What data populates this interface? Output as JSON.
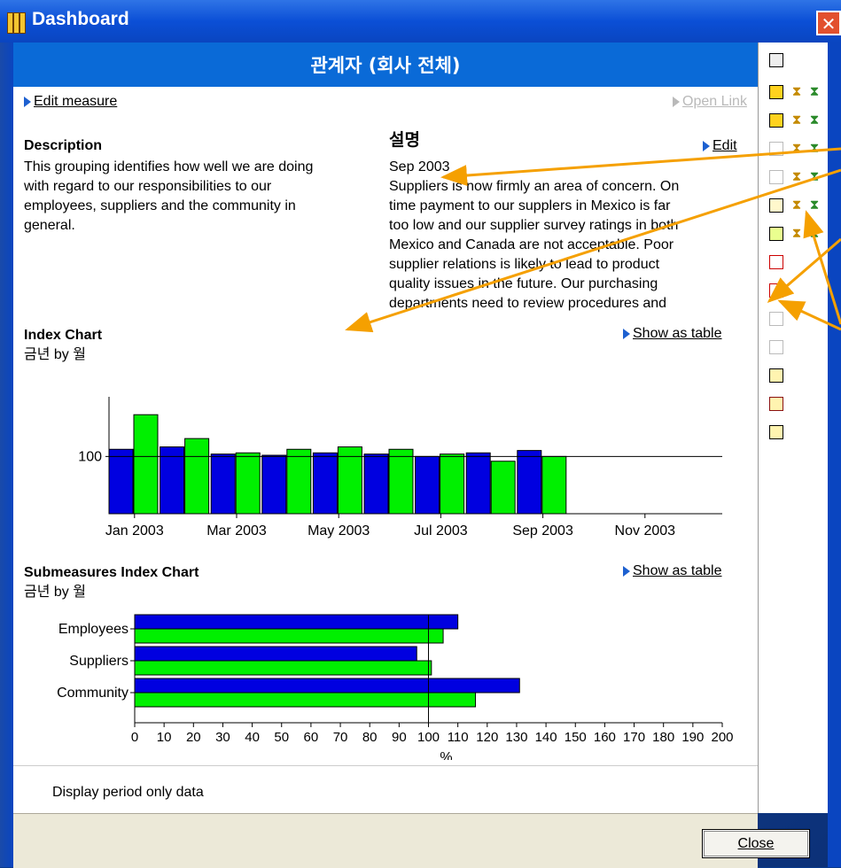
{
  "window": {
    "title": "Dashboard"
  },
  "header": {
    "title": "관계자 (회사 전체)"
  },
  "links": {
    "edit_measure": "Edit measure",
    "open_link": "Open Link",
    "edit": "Edit",
    "show_as_table_1": "Show as table",
    "show_as_table_2": "Show as table"
  },
  "description": {
    "heading": "Description",
    "lines": [
      "This grouping identifies how well we are doing",
      "with regard to our responsibilities to our",
      "employees, suppliers and the community in",
      "general."
    ]
  },
  "commentary": {
    "heading": "설명",
    "date": "Sep 2003",
    "lines": [
      "Suppliers is now firmly an area of concern.  On",
      "time payment to our supplers in Mexico is far",
      "too low and our supplier survey ratings in both",
      "Mexico and Canada are not acceptable.  Poor",
      "supplier relations is likely to lead to product",
      "quality issues in the future.  Our purchasing",
      "departments need to review procedures and"
    ]
  },
  "index_chart_titles": {
    "title": "Index Chart",
    "subtitle": "금년 by 월",
    "y_marker": "100"
  },
  "sub_chart_titles": {
    "title": "Submeasures Index Chart",
    "subtitle": "금년 by 월"
  },
  "chart_data": [
    {
      "type": "bar",
      "title": "Index Chart",
      "subtitle": "금년 by 월",
      "xlabel": "",
      "ylabel": "",
      "x_tick_labels": [
        "Jan 2003",
        "Mar 2003",
        "May 2003",
        "Jul 2003",
        "Sep 2003",
        "Nov 2003"
      ],
      "categories": [
        "Jan 2003",
        "Feb 2003",
        "Mar 2003",
        "Apr 2003",
        "May 2003",
        "Jun 2003",
        "Jul 2003",
        "Aug 2003",
        "Sep 2003",
        "Oct 2003",
        "Nov 2003",
        "Dec 2003"
      ],
      "reference_line": 100,
      "series": [
        {
          "values": [
            106,
            108,
            102,
            101,
            103,
            102,
            100,
            103,
            105,
            null,
            null,
            null
          ],
          "color": "#0000e0"
        },
        {
          "values": [
            135,
            115,
            103,
            106,
            108,
            106,
            102,
            96,
            100,
            null,
            null,
            null
          ],
          "color": "#00f000"
        }
      ],
      "ylim": [
        52,
        150
      ]
    },
    {
      "type": "bar",
      "orientation": "horizontal",
      "title": "Submeasures Index Chart",
      "subtitle": "금년 by 월",
      "xlabel": "%",
      "categories": [
        "Employees",
        "Suppliers",
        "Community"
      ],
      "series": [
        {
          "values": [
            110,
            96,
            131
          ],
          "color": "#0000e0"
        },
        {
          "values": [
            105,
            101,
            116
          ],
          "color": "#00f000"
        }
      ],
      "xlim": [
        0,
        200
      ],
      "xticks": [
        0,
        10,
        20,
        30,
        40,
        50,
        60,
        70,
        80,
        90,
        100,
        110,
        120,
        130,
        140,
        150,
        160,
        170,
        180,
        190,
        200
      ],
      "reference_line": 100
    }
  ],
  "footer": {
    "checkbox_label": "Display period only data",
    "close_label": "Close"
  },
  "colors": {
    "accent": "#0a6ad7",
    "arrow": "#f5a000",
    "blue_series": "#0000e0",
    "green_series": "#00f000"
  }
}
